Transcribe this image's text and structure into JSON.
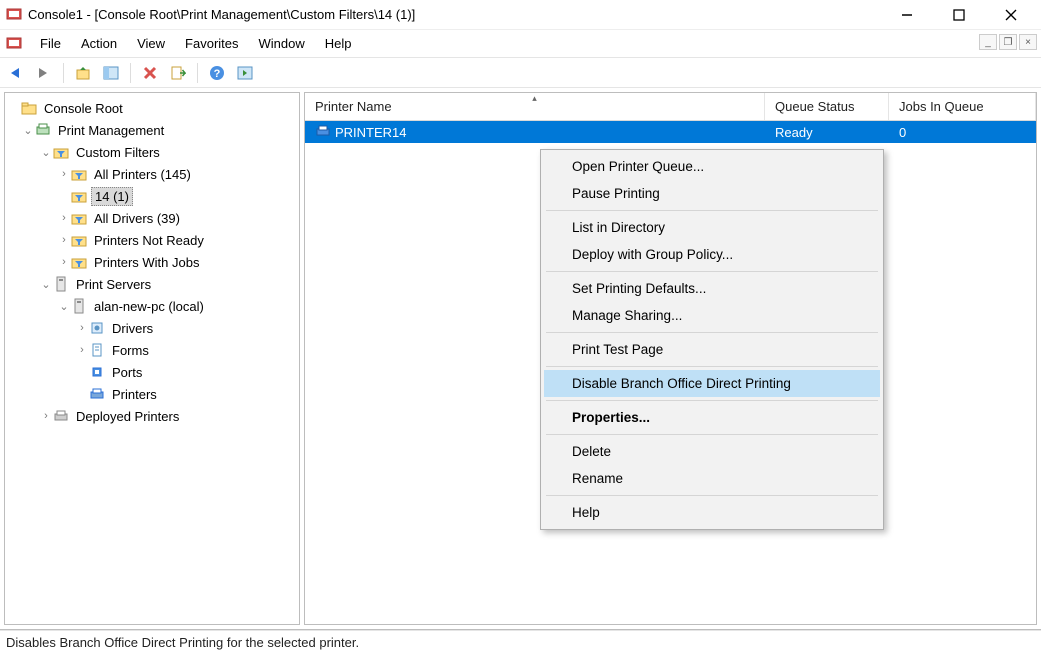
{
  "window": {
    "title": "Console1 - [Console Root\\Print Management\\Custom Filters\\14 (1)]"
  },
  "menubar": {
    "items": [
      "File",
      "Action",
      "View",
      "Favorites",
      "Window",
      "Help"
    ]
  },
  "tree": {
    "root": "Console Root",
    "pm": "Print Management",
    "cf": "Custom Filters",
    "cf_items": {
      "all_printers": "All Printers (145)",
      "filter14": "14 (1)",
      "all_drivers": "All Drivers (39)",
      "not_ready": "Printers Not Ready",
      "with_jobs": "Printers With Jobs"
    },
    "ps": "Print Servers",
    "server": "alan-new-pc (local)",
    "server_items": {
      "drivers": "Drivers",
      "forms": "Forms",
      "ports": "Ports",
      "printers": "Printers"
    },
    "deployed": "Deployed Printers"
  },
  "columns": {
    "name": "Printer Name",
    "status": "Queue Status",
    "jobs": "Jobs In Queue"
  },
  "row": {
    "name": "PRINTER14",
    "status": "Ready",
    "jobs": "0"
  },
  "context_menu": {
    "open_queue": "Open Printer Queue...",
    "pause": "Pause Printing",
    "list_dir": "List in Directory",
    "deploy_gp": "Deploy with Group Policy...",
    "set_defaults": "Set Printing Defaults...",
    "manage_sharing": "Manage Sharing...",
    "test_page": "Print Test Page",
    "disable_bodp": "Disable Branch Office Direct Printing",
    "properties": "Properties...",
    "delete": "Delete",
    "rename": "Rename",
    "help": "Help"
  },
  "statusbar": {
    "text": "Disables Branch Office Direct Printing for the selected printer."
  }
}
